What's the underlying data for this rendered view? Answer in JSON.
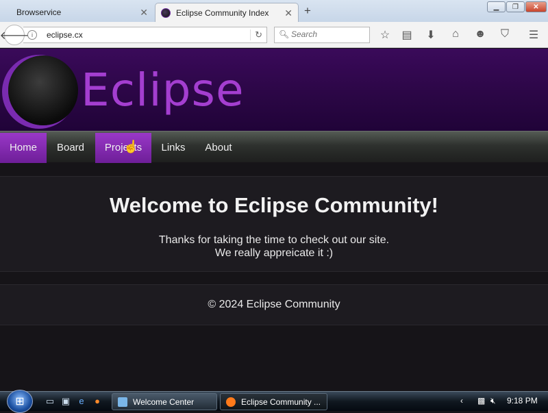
{
  "browser": {
    "tabs": [
      {
        "title": "Browservice",
        "active": false
      },
      {
        "title": "Eclipse Community Index",
        "active": true
      }
    ],
    "new_tab": "+",
    "address": "eclipse.cx",
    "search_placeholder": "Search",
    "icons": [
      "back-icon",
      "info-icon",
      "reload-icon",
      "search-icon",
      "bookmark-star-icon",
      "reading-list-icon",
      "download-icon",
      "home-icon",
      "smiley-icon",
      "pocket-icon",
      "hamburger-menu-icon"
    ]
  },
  "site": {
    "logo_text": "Eclipse",
    "nav": [
      {
        "label": "Home",
        "highlighted": true
      },
      {
        "label": "Board",
        "highlighted": false
      },
      {
        "label": "Projects",
        "highlighted": true
      },
      {
        "label": "Links",
        "highlighted": false
      },
      {
        "label": "About",
        "highlighted": false
      }
    ],
    "welcome_title": "Welcome to Eclipse Community!",
    "welcome_line1": "Thanks for taking the time to check out our site.",
    "welcome_line2": "We really appreicate it :)",
    "footer": "© 2024 Eclipse Community",
    "accent": "#9a38c8"
  },
  "taskbar": {
    "buttons": [
      {
        "label": "Welcome Center",
        "active": false
      },
      {
        "label": "Eclipse Community ...",
        "active": true
      }
    ],
    "clock": "9:18 PM"
  }
}
